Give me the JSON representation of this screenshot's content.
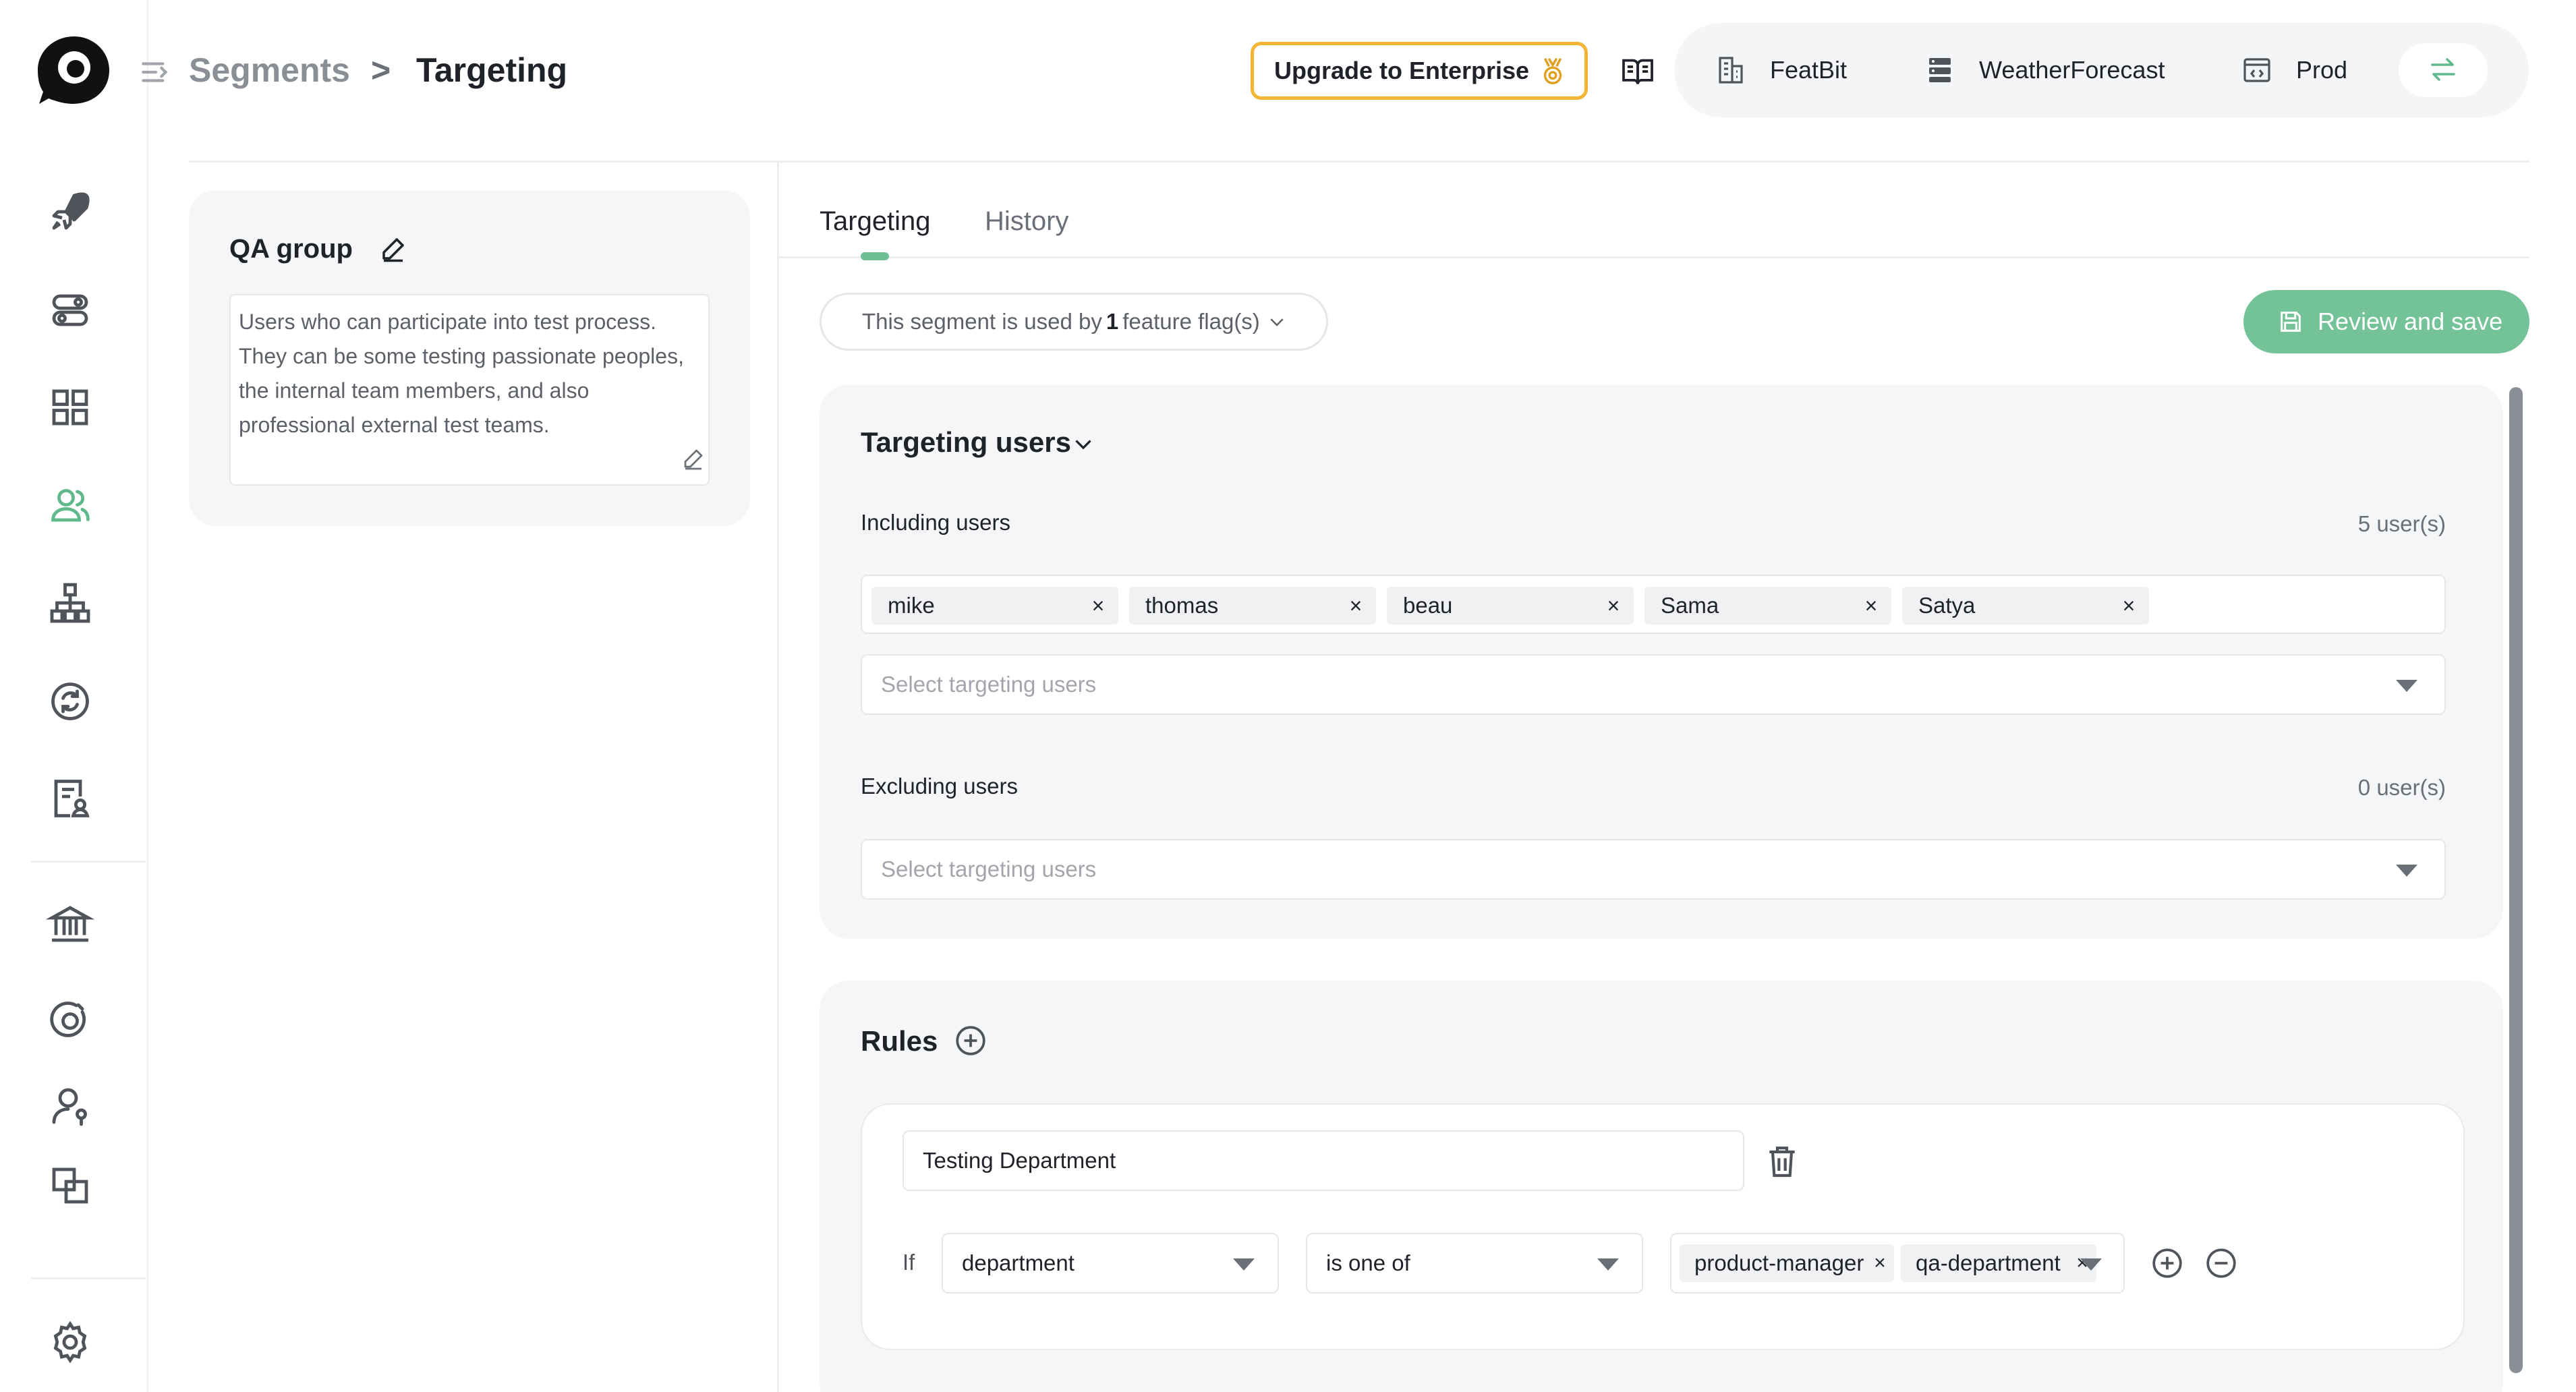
{
  "header": {
    "breadcrumb": {
      "parent": "Segments",
      "separator": ">",
      "current": "Targeting"
    },
    "upgrade_label": "Upgrade to Enterprise",
    "context": {
      "organization": "FeatBit",
      "project": "WeatherForecast",
      "environment": "Prod"
    }
  },
  "segment": {
    "name": "QA group",
    "description": "Users who can participate into test process. They can be some testing passionate peoples, the internal team members, and also professional external test teams."
  },
  "tabs": [
    {
      "label": "Targeting",
      "active": true
    },
    {
      "label": "History",
      "active": false
    }
  ],
  "usage": {
    "prefix": "This segment is used by",
    "count": "1",
    "suffix": "feature flag(s)"
  },
  "review_label": "Review and save",
  "targeting": {
    "title": "Targeting users",
    "including": {
      "label": "Including users",
      "count_text": "5 user(s)",
      "users": [
        "mike",
        "thomas",
        "beau",
        "Sama",
        "Satya"
      ],
      "placeholder": "Select targeting users"
    },
    "excluding": {
      "label": "Excluding users",
      "count_text": "0 user(s)",
      "placeholder": "Select targeting users"
    }
  },
  "rules": {
    "title": "Rules",
    "items": [
      {
        "name": "Testing Department",
        "if_label": "If",
        "property": "department",
        "operator": "is one of",
        "values": [
          "product-manager",
          "qa-department"
        ]
      }
    ]
  },
  "colors": {
    "accent_green": "#74c398",
    "upgrade_border": "#f2b432"
  },
  "icons": {
    "nav": [
      "rocket-icon",
      "toggle-icon",
      "grid-icon",
      "users-icon",
      "hierarchy-icon",
      "sync-icon",
      "audit-report-icon",
      "bank-icon",
      "target-icon",
      "user-key-icon",
      "layers-icon",
      "gear-icon"
    ]
  }
}
